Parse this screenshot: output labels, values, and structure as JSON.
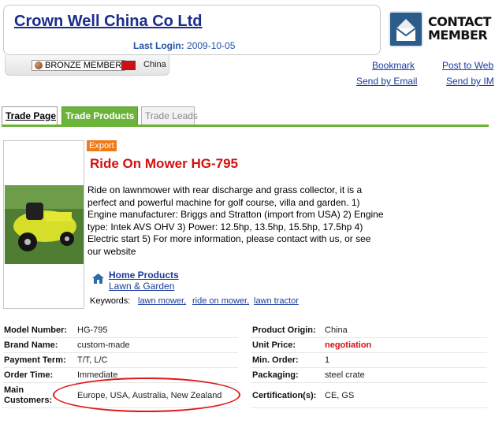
{
  "header": {
    "company_name": "Crown Well China Co Ltd",
    "last_login_label": "Last Login:",
    "last_login_date": "2009-10-05",
    "contact_label_line1": "CONTACT",
    "contact_label_line2": "MEMBER"
  },
  "member": {
    "badge": "BRONZE MEMBER",
    "country": "China"
  },
  "actions": {
    "bookmark": "Bookmark",
    "post_to_web": "Post to Web",
    "send_by_email": "Send by Email",
    "send_by_im": "Send by IM"
  },
  "tabs": [
    {
      "label": "Trade Page"
    },
    {
      "label": "Trade Products",
      "active": true
    },
    {
      "label": "Trade Leads"
    }
  ],
  "product": {
    "badge": "Export",
    "title": "Ride On Mower HG-795",
    "description": "Ride on lawnmower with rear discharge and grass collector, it is a perfect and powerful machine for golf course, villa and garden. 1) Engine manufacturer: Briggs and Stratton (import from USA) 2) Engine type: Intek AVS OHV 3) Power: 12.5hp, 13.5hp, 15.5hp, 17.5hp 4) Electric start 5) For more information, please contact with us, or see our website",
    "category_main": "Home Products",
    "category_sub": "Lawn & Garden",
    "keywords_label": "Keywords:",
    "keywords": [
      "lawn mower,",
      "ride on mower,",
      "lawn tractor"
    ]
  },
  "details": {
    "model_number_label": "Model Number:",
    "model_number": "HG-795",
    "brand_name_label": "Brand Name:",
    "brand_name": "custom-made",
    "payment_term_label": "Payment Term:",
    "payment_term": "T/T, L/C",
    "order_time_label": "Order Time:",
    "order_time": "Immediate",
    "main_customers_label_1": "Main",
    "main_customers_label_2": "Customers:",
    "main_customers": "Europe, USA, Australia, New Zealand",
    "product_origin_label": "Product Origin:",
    "product_origin": "China",
    "unit_price_label": "Unit Price:",
    "unit_price": "negotiation",
    "min_order_label": "Min. Order:",
    "min_order": "1",
    "packaging_label": "Packaging:",
    "packaging": "steel crate",
    "certification_label": "Certification(s):",
    "certification": "CE, GS"
  },
  "colors": {
    "brand_blue": "#1a2c8c",
    "tab_green": "#6bb33a",
    "title_red": "#d41010",
    "export_orange": "#f07a16"
  },
  "icons": [
    "envelope-icon",
    "medal-icon",
    "china-flag-icon",
    "house-icon"
  ]
}
